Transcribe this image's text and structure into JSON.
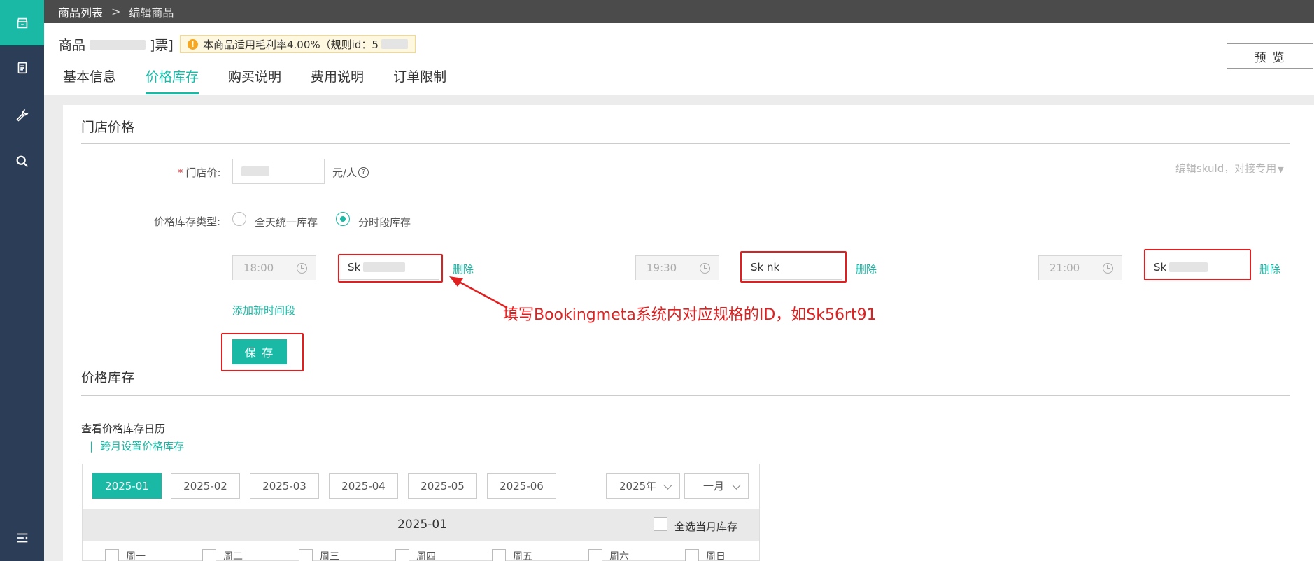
{
  "colors": {
    "accent": "#19b9a6",
    "sidebar": "#2c3e57",
    "topbar": "#4b4b4b",
    "annotation": "#e02020"
  },
  "sidebar": {
    "icons": [
      "store-icon",
      "document-icon",
      "wrench-icon",
      "search-icon",
      "menu-collapse-icon"
    ]
  },
  "breadcrumb": {
    "root": "商品列表",
    "separator": ">",
    "current": "编辑商品"
  },
  "product": {
    "title_prefix": "商品",
    "title_suffix": "]票]",
    "notice": "本商品适用毛利率4.00%（规则id：5"
  },
  "header": {
    "preview_label": "预 览"
  },
  "tabs": [
    "基本信息",
    "价格库存",
    "购买说明",
    "费用说明",
    "订单限制"
  ],
  "store_price": {
    "section_title": "门店价格",
    "price_label": "门店价:",
    "price_unit": "元/人",
    "help_icon": "question-circle-icon",
    "skuid_toggle": "编辑skuld，对接专用",
    "type_label": "价格库存类型:",
    "type_options": [
      "全天统一库存",
      "分时段库存"
    ],
    "type_selected": "分时段库存",
    "slots": [
      {
        "time": "18:00",
        "sku": "Sk",
        "delete": "删除"
      },
      {
        "time": "19:30",
        "sku": "Sk      nk",
        "delete": "删除"
      },
      {
        "time": "21:00",
        "sku": "Sk",
        "delete": "删除"
      }
    ],
    "add_slot": "添加新时间段",
    "save_label": "保 存"
  },
  "annotation": "填写Bookingmeta系统内对应规格的ID，如Sk56rt91",
  "inventory": {
    "section_title": "价格库存",
    "calendar_label": "查看价格库存日历",
    "cross_month_link": "跨月设置价格库存",
    "months": [
      "2025-01",
      "2025-02",
      "2025-03",
      "2025-04",
      "2025-05",
      "2025-06"
    ],
    "active_month": "2025-01",
    "year_select": "2025年",
    "month_select": "一月",
    "calendar_title": "2025-01",
    "select_all": "全选当月库存",
    "weekdays": [
      "周一",
      "周二",
      "周三",
      "周四",
      "周五",
      "周六",
      "周日"
    ]
  }
}
